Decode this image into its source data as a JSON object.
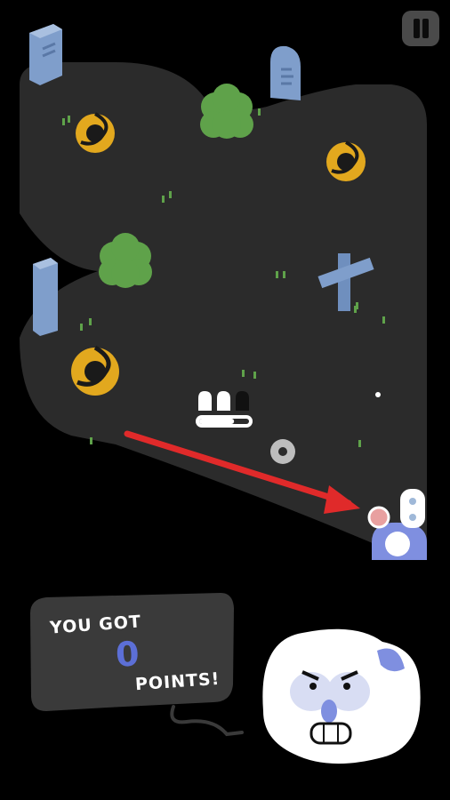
{
  "hud": {
    "pause_icon": "pause-icon",
    "ghost_lives_total": 3,
    "ghost_lives_filled": 2,
    "charge_fraction": 0.7
  },
  "result": {
    "prefix": "YOU GOT",
    "points": "0",
    "suffix": "POINTS!"
  },
  "colors": {
    "ground": "#2b2b2b",
    "tombstone": "#7f9ecb",
    "bush": "#5fa24a",
    "portal": "#e2a81e",
    "arrow": "#e02a2a",
    "mascot_accent": "#7f8fe0"
  }
}
